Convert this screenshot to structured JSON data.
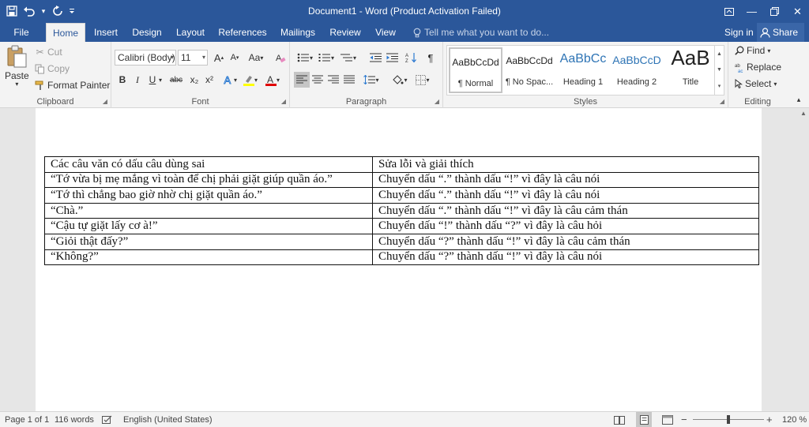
{
  "window": {
    "title": "Document1 - Word (Product Activation Failed)",
    "qat_save_icon": "save-icon",
    "qat_undo_icon": "undo-icon",
    "qat_redo_icon": "redo-icon",
    "minimize": "—",
    "maximize": "❐",
    "close": "✕"
  },
  "tabs": [
    "File",
    "Home",
    "Insert",
    "Design",
    "Layout",
    "References",
    "Mailings",
    "Review",
    "View"
  ],
  "tellme": "Tell me what you want to do...",
  "account": {
    "signin": "Sign in",
    "share": "Share"
  },
  "clipboard": {
    "paste": "Paste",
    "cut": "Cut",
    "copy": "Copy",
    "format_painter": "Format Painter",
    "label": "Clipboard"
  },
  "font": {
    "family": "Calibri (Body)",
    "size": "11",
    "label": "Font",
    "grow": "A",
    "shrink": "A",
    "case": "Aa",
    "bold": "B",
    "italic": "I",
    "underline": "U",
    "strike": "abc",
    "subscript": "x₂",
    "superscript": "x²"
  },
  "paragraph": {
    "label": "Paragraph",
    "pilcrow": "¶"
  },
  "styles": {
    "label": "Styles",
    "items": [
      {
        "sample": "AaBbCcDd",
        "name": "¶ Normal"
      },
      {
        "sample": "AaBbCcDd",
        "name": "¶ No Spac..."
      },
      {
        "sample": "AaBbCc",
        "name": "Heading 1"
      },
      {
        "sample": "AaBbCcD",
        "name": "Heading 2"
      },
      {
        "sample": "AaB",
        "name": "Title"
      }
    ]
  },
  "editing": {
    "find": "Find",
    "replace": "Replace",
    "select": "Select",
    "label": "Editing"
  },
  "table": {
    "header": [
      "Các câu văn có dấu câu dùng sai",
      "Sửa lỗi và giải thích"
    ],
    "rows": [
      [
        "“Tớ vừa bị mẹ mắng vì toàn để chị phải giặt giúp quần áo.”",
        "Chuyển dấu “.” thành dấu “!” vì đây là câu nói"
      ],
      [
        "“Tớ thì chẳng bao giờ nhờ chị giặt quần áo.”",
        "Chuyển dấu “.” thành dấu “!” vì đây là câu nói"
      ],
      [
        "“Chà.”",
        "Chuyển dấu “.” thành dấu “!” vì đây là câu cảm thán"
      ],
      [
        "“Cậu tự giặt lấy cơ à!”",
        "Chuyển dấu “!” thành dấu “?” vì đây là câu hỏi"
      ],
      [
        "“Giỏi thật đấy?”",
        "Chuyển dấu “?” thành dấu “!” vì đây là câu cảm thán"
      ],
      [
        "“Không?”",
        "Chuyển dấu “?” thành dấu “!” vì đây là câu nói"
      ]
    ]
  },
  "status": {
    "page": "Page 1 of 1",
    "words": "116 words",
    "language": "English (United States)",
    "zoom": "120 %",
    "zoom_minus": "−",
    "zoom_plus": "+"
  },
  "colors": {
    "brand": "#2b579a",
    "highlight": "#ffff00",
    "font_color": "#e00000"
  }
}
